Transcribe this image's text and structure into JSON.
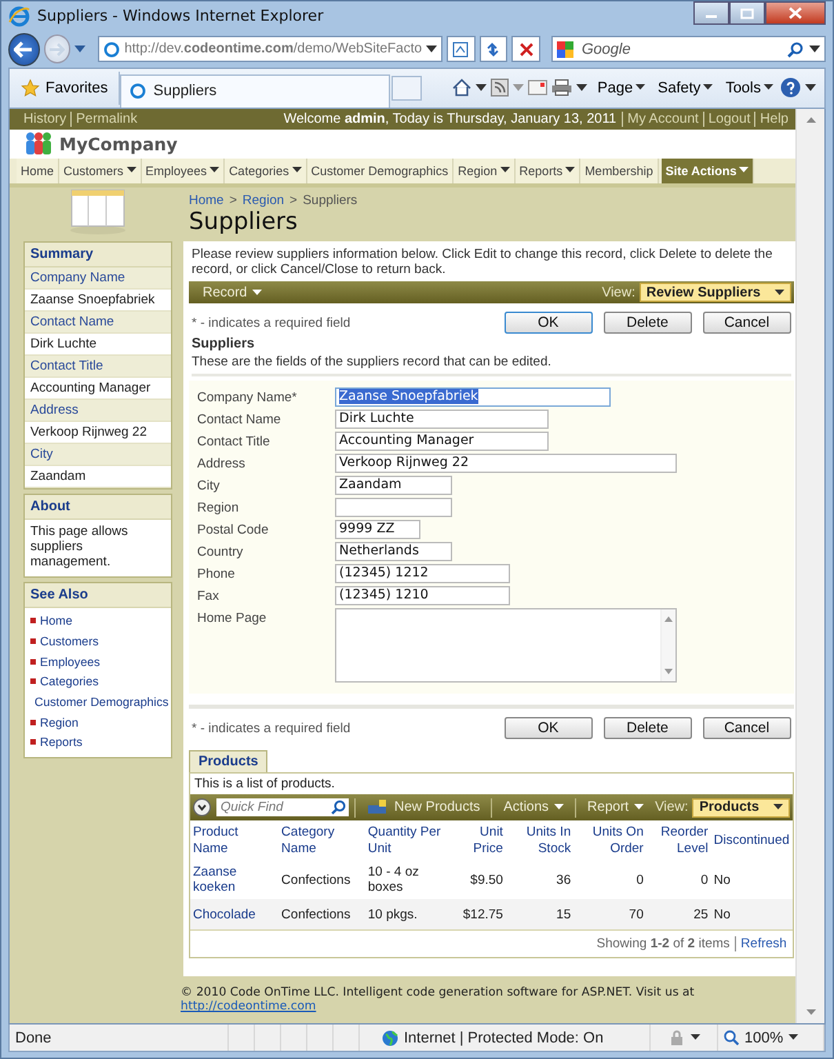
{
  "window": {
    "title": "Suppliers - Windows Internet Explorer"
  },
  "address_bar": {
    "url": "http://dev.**codeontime.com**/demo/WebSiteFacto"
  },
  "search": {
    "placeholder": "Google"
  },
  "favorites": {
    "label": "Favorites"
  },
  "browser_tab": {
    "title": "Suppliers"
  },
  "command_bar": {
    "menus": [
      "Page",
      "Safety",
      "Tools"
    ]
  },
  "top_bar": {
    "links_left": [
      "History",
      "Permalink"
    ],
    "welcome": "Welcome **admin**, Today is Thursday, January 13, 2011",
    "links_right": [
      "My Account",
      "Logout",
      "Help"
    ]
  },
  "site": {
    "name": "MyCompany"
  },
  "menu": [
    {
      "label": "Home",
      "dropdown": false,
      "kind": "link"
    },
    {
      "label": "Customers",
      "dropdown": true,
      "kind": "link"
    },
    {
      "label": "Employees",
      "dropdown": true,
      "kind": "link"
    },
    {
      "label": "Categories",
      "dropdown": true,
      "kind": "link"
    },
    {
      "label": "Customer Demographics",
      "dropdown": false,
      "kind": "link"
    },
    {
      "label": "Region",
      "dropdown": true,
      "kind": "link"
    },
    {
      "label": "Reports",
      "dropdown": true,
      "kind": "link"
    },
    {
      "label": "Membership",
      "dropdown": false,
      "kind": "link"
    },
    {
      "label": "Site Actions",
      "dropdown": true,
      "kind": "actions"
    }
  ],
  "sidebar": {
    "summary": {
      "title": "Summary",
      "fields": [
        {
          "label": "Company Name",
          "value": "Zaanse Snoepfabriek"
        },
        {
          "label": "Contact Name",
          "value": "Dirk Luchte"
        },
        {
          "label": "Contact Title",
          "value": "Accounting Manager"
        },
        {
          "label": "Address",
          "value": "Verkoop Rijnweg 22"
        },
        {
          "label": "City",
          "value": "Zaandam"
        }
      ]
    },
    "about": {
      "title": "About",
      "text": "This page allows suppliers management."
    },
    "see_also": {
      "title": "See Also",
      "links": [
        "Home",
        "Customers",
        "Employees",
        "Categories",
        "Customer Demographics",
        "Region",
        "Reports"
      ]
    }
  },
  "breadcrumb": {
    "items": [
      "Home",
      "Region",
      "Suppliers"
    ],
    "separator": ">"
  },
  "page_title": "Suppliers",
  "description": "Please review suppliers information below. Click Edit to change this record, click Delete to delete the record, or click Cancel/Close to return back.",
  "record_bar": {
    "menu": "Record",
    "view_label": "View:",
    "view": "Review Suppliers"
  },
  "required_note_top": "* - indicates a required field",
  "buttons_top": [
    "OK",
    "Delete",
    "Cancel"
  ],
  "form": {
    "title": "Suppliers",
    "required_mark": "*",
    "description": "These are the fields of the suppliers record that can be edited.",
    "fields": [
      {
        "label": "Company Name",
        "required": true,
        "value": "Zaanse Snoepfabriek",
        "highlighted": true,
        "kind": "text"
      },
      {
        "label": "Contact Name",
        "required": false,
        "value": "Dirk Luchte",
        "highlighted": false,
        "kind": "text"
      },
      {
        "label": "Contact Title",
        "required": false,
        "value": "Accounting Manager",
        "highlighted": false,
        "kind": "text"
      },
      {
        "label": "Address",
        "required": false,
        "value": "Verkoop Rijnweg 22",
        "highlighted": false,
        "kind": "text"
      },
      {
        "label": "City",
        "required": false,
        "value": "Zaandam",
        "highlighted": false,
        "kind": "text"
      },
      {
        "label": "Region",
        "required": false,
        "highlighted": false,
        "kind": "text"
      },
      {
        "label": "Postal Code",
        "required": false,
        "value": "9999 ZZ",
        "highlighted": false,
        "kind": "text"
      },
      {
        "label": "Country",
        "required": false,
        "value": "Netherlands",
        "highlighted": false,
        "kind": "text"
      },
      {
        "label": "Phone",
        "required": false,
        "value": "(12345) 1212",
        "highlighted": false,
        "kind": "text"
      },
      {
        "label": "Fax",
        "required": false,
        "value": "(12345) 1210",
        "highlighted": false,
        "kind": "text"
      },
      {
        "label": "Home Page",
        "required": false,
        "highlighted": false,
        "kind": "textarea"
      }
    ]
  },
  "required_note_bottom": "* - indicates a required field",
  "buttons_bottom": [
    "OK",
    "Delete",
    "Cancel"
  ],
  "products": {
    "tab": "Products",
    "description": "This is a list of products.",
    "toolbar": {
      "quick_find": {
        "placeholder": "Quick Find"
      },
      "new": "New Products",
      "actions": "Actions",
      "report": "Report",
      "view_label": "View:",
      "view": "Products"
    },
    "columns": [
      {
        "label": "Product Name",
        "kind": "text"
      },
      {
        "label": "Category Name",
        "kind": "text"
      },
      {
        "label": "Quantity Per Unit",
        "kind": "text"
      },
      {
        "label": "Unit Price",
        "kind": "number"
      },
      {
        "label": "Units In Stock",
        "kind": "number"
      },
      {
        "label": "Units On Order",
        "kind": "number"
      },
      {
        "label": "Reorder Level",
        "kind": "number"
      },
      {
        "label": "Discontinued",
        "kind": "text"
      }
    ],
    "rows": [
      [
        "Zaanse koeken",
        "Confections",
        "10 - 4 oz boxes",
        "$9.50",
        "36",
        "0",
        "0",
        "No"
      ],
      [
        "Chocolade",
        "Confections",
        "10 pkgs.",
        "$12.75",
        "15",
        "70",
        "25",
        "No"
      ]
    ],
    "paging": "Showing **1-2** of **2** items",
    "refresh": "Refresh"
  },
  "footer": {
    "text": "© 2010 Code OnTime LLC. Intelligent code generation software for ASP.NET. Visit us at",
    "link": "http://codeontime.com"
  },
  "status_bar": {
    "status": "Done",
    "zone": "Internet | Protected Mode: On",
    "zoom": "100%"
  }
}
